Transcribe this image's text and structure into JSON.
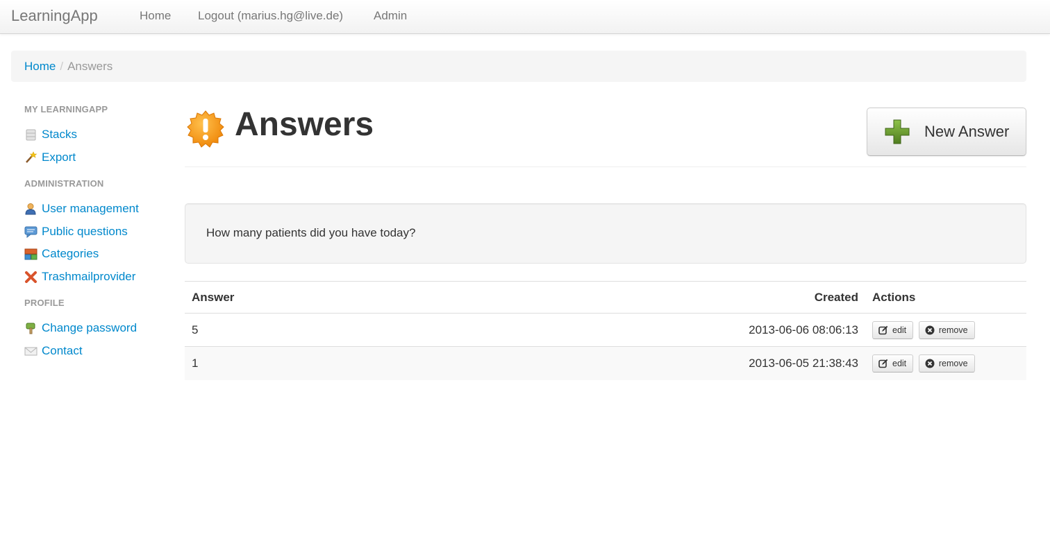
{
  "navbar": {
    "brand": "LearningApp",
    "items": [
      {
        "label": "Home"
      },
      {
        "label": "Logout (marius.hg@live.de)"
      },
      {
        "label": "Admin"
      }
    ]
  },
  "breadcrumb": {
    "home": "Home",
    "separator": "/",
    "current": "Answers"
  },
  "sidebar": {
    "sections": [
      {
        "header": "MY LEARNINGAPP",
        "items": [
          {
            "label": "Stacks",
            "icon": "database-icon"
          },
          {
            "label": "Export",
            "icon": "magic-wand-icon"
          }
        ]
      },
      {
        "header": "ADMINISTRATION",
        "items": [
          {
            "label": "User management",
            "icon": "user-icon"
          },
          {
            "label": "Public questions",
            "icon": "speech-bubble-icon"
          },
          {
            "label": "Categories",
            "icon": "categories-icon"
          },
          {
            "label": "Trashmailprovider",
            "icon": "cross-icon"
          }
        ]
      },
      {
        "header": "PROFILE",
        "items": [
          {
            "label": "Change password",
            "icon": "key-icon"
          },
          {
            "label": "Contact",
            "icon": "envelope-icon"
          }
        ]
      }
    ]
  },
  "page": {
    "title": "Answers",
    "title_icon": "exclamation-badge-icon",
    "new_button": "New Answer"
  },
  "question": {
    "text": "How many patients did you have today?"
  },
  "table": {
    "headers": {
      "answer": "Answer",
      "created": "Created",
      "actions": "Actions"
    },
    "rows": [
      {
        "answer": "5",
        "created": "2013-06-06 08:06:13",
        "edit": "edit",
        "remove": "remove"
      },
      {
        "answer": "1",
        "created": "2013-06-05 21:38:43",
        "edit": "edit",
        "remove": "remove"
      }
    ]
  },
  "colors": {
    "link": "#0088cc",
    "muted": "#999999",
    "icon_orange": "#f7931e",
    "plus_green": "#6a9a2f"
  }
}
